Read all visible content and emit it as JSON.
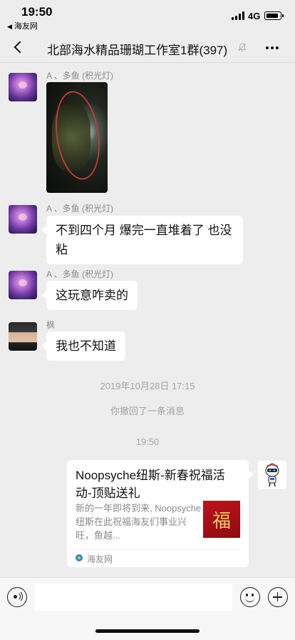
{
  "status_bar": {
    "time": "19:50",
    "back_app": "海友网",
    "network": "4G"
  },
  "nav": {
    "title": "北部海水精品珊瑚工作室1群(397)",
    "mute_icon": "bell-slash-icon",
    "back_icon": "chevron-left-icon",
    "more_icon": "ellipsis-icon"
  },
  "messages": [
    {
      "sender": "A        、多鱼 (积光灯)",
      "type": "image"
    },
    {
      "sender": "A        、多鱼 (积光灯)",
      "text": "不到四个月 爆完一直堆着了 也没粘"
    },
    {
      "sender": "A        、多鱼 (积光灯)",
      "text": "这玩意咋卖的"
    },
    {
      "sender": "枫",
      "text": "我也不知道"
    }
  ],
  "system": {
    "date_stamp": "2019年10月28日 17:15",
    "recall_notice": "你撤回了一条消息",
    "time_stamp": "19:50"
  },
  "link_card": {
    "title": "Noopsyche纽斯-新春祝福活动-顶贴送礼",
    "description": "新的一年即将到来, Noopsyche纽斯在此祝福海友们事业兴旺，鱼越...",
    "thumb_char": "福",
    "source": "海友网"
  },
  "input_bar": {
    "voice_icon": "voice-icon",
    "emoji_icon": "emoji-icon",
    "plus_icon": "plus-icon"
  },
  "colors": {
    "background": "#ededed",
    "bubble": "#ffffff",
    "annotation_circle": "#c23a32"
  }
}
